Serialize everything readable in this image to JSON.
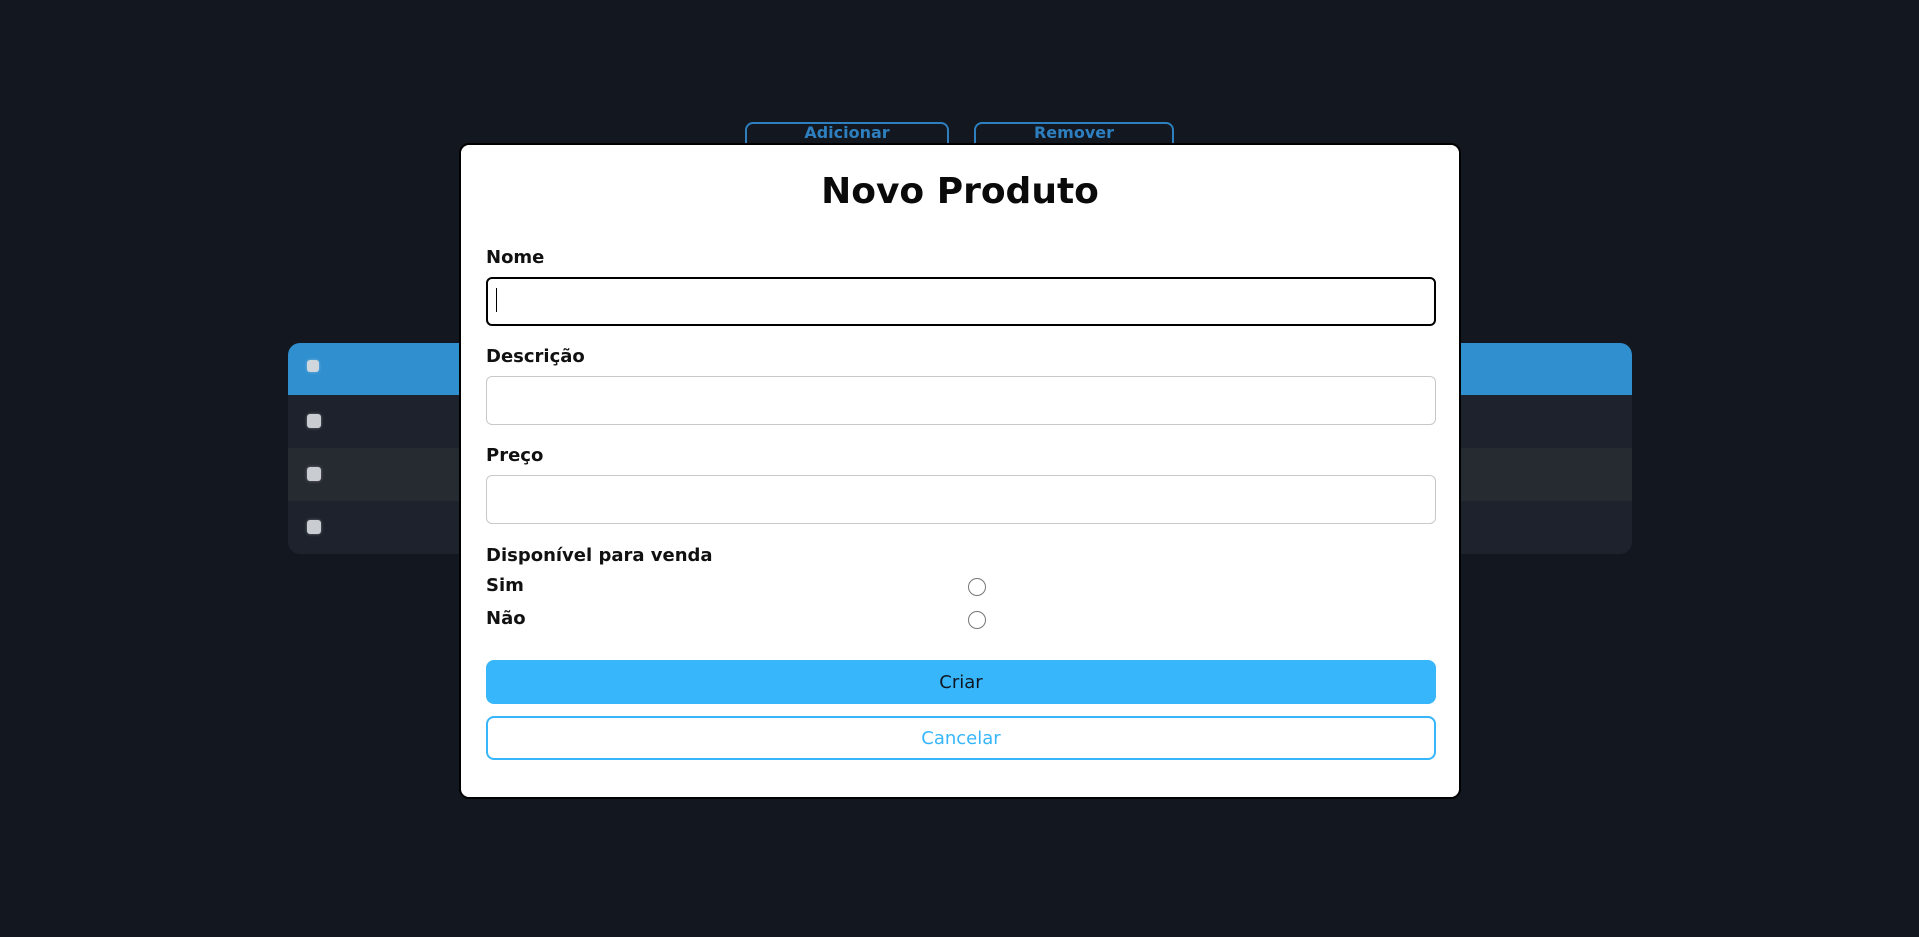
{
  "background": {
    "toolbar": {
      "add_label": "Adicionar Produto",
      "remove_label": "Remover Produto"
    },
    "table": {
      "row_count": 3
    }
  },
  "modal": {
    "title": "Novo Produto",
    "fields": {
      "nome": {
        "label": "Nome",
        "value": ""
      },
      "descricao": {
        "label": "Descrição",
        "value": ""
      },
      "preco": {
        "label": "Preço",
        "value": ""
      }
    },
    "availability": {
      "label": "Disponível para venda",
      "options": [
        {
          "label": "Sim",
          "checked": false
        },
        {
          "label": "Não",
          "checked": false
        }
      ]
    },
    "buttons": {
      "create_label": "Criar",
      "cancel_label": "Cancelar"
    }
  },
  "colors": {
    "page_background": "#13171f",
    "accent": "#38b6fb",
    "table_header": "#2f8fcf"
  }
}
